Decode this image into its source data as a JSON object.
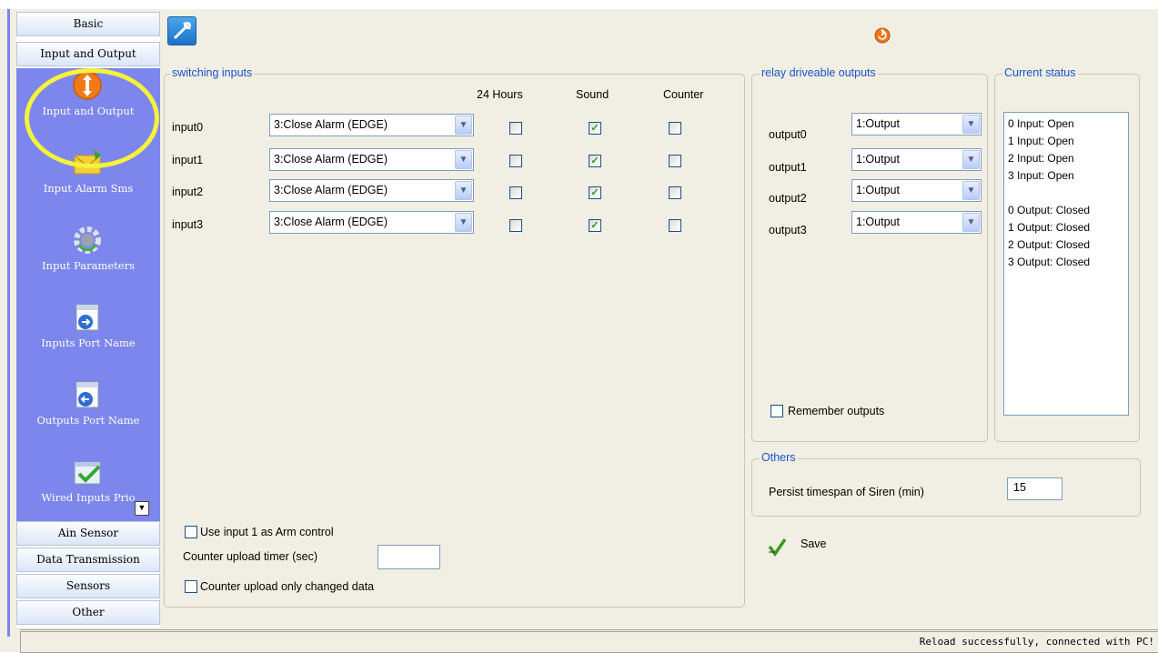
{
  "sidebar": {
    "header_basic": "Basic",
    "header_io": "Input and Output",
    "items": [
      {
        "label": "Input and Output",
        "icon": "io-arrows-icon"
      },
      {
        "label": "Input Alarm Sms",
        "icon": "sms-envelope-icon"
      },
      {
        "label": "Input Parameters",
        "icon": "gear-parameters-icon"
      },
      {
        "label": "Inputs Port Name",
        "icon": "inputs-port-name-icon"
      },
      {
        "label": "Outputs Port Name",
        "icon": "outputs-port-name-icon"
      },
      {
        "label": "Wired Inputs Prio",
        "icon": "checkmark-window-icon"
      }
    ],
    "bottom_headers": [
      "Ain Sensor",
      "Data Transmission",
      "Sensors",
      "Other"
    ]
  },
  "switching": {
    "title": "switching inputs",
    "col_24h": "24 Hours",
    "col_sound": "Sound",
    "col_counter": "Counter",
    "rows": [
      {
        "label": "input0",
        "mode": "3:Close Alarm (EDGE)",
        "h24": false,
        "sound": true,
        "counter": false
      },
      {
        "label": "input1",
        "mode": "3:Close Alarm (EDGE)",
        "h24": false,
        "sound": true,
        "counter": false
      },
      {
        "label": "input2",
        "mode": "3:Close Alarm (EDGE)",
        "h24": false,
        "sound": true,
        "counter": false
      },
      {
        "label": "input3",
        "mode": "3:Close Alarm (EDGE)",
        "h24": false,
        "sound": true,
        "counter": false
      }
    ],
    "arm_control_label": "Use input 1 as Arm control",
    "counter_timer_label": "Counter upload timer (sec)",
    "counter_timer_value": "",
    "counter_changed_label": "Counter upload only changed data"
  },
  "relay": {
    "title": "relay driveable outputs",
    "rows": [
      {
        "label": "output0",
        "mode": "1:Output"
      },
      {
        "label": "output1",
        "mode": "1:Output"
      },
      {
        "label": "output2",
        "mode": "1:Output"
      },
      {
        "label": "output3",
        "mode": "1:Output"
      }
    ],
    "remember_label": "Remember outputs"
  },
  "status": {
    "title": "Current status",
    "lines": [
      "0  Input: Open",
      "1  Input: Open",
      "2  Input: Open",
      "3  Input: Open",
      "",
      "0 Output: Closed",
      "1 Output: Closed",
      "2 Output: Closed",
      "3 Output: Closed"
    ]
  },
  "others": {
    "title": "Others",
    "siren_label": "Persist timespan of Siren (min)",
    "siren_value": "15"
  },
  "save_label": "Save",
  "statusbar_text": "Reload successfully, connected with PC!",
  "colors": {
    "sidebar_panel": "#7c86ec",
    "groupbox_title": "#1a52c9",
    "window_bg": "#f1efe3"
  }
}
